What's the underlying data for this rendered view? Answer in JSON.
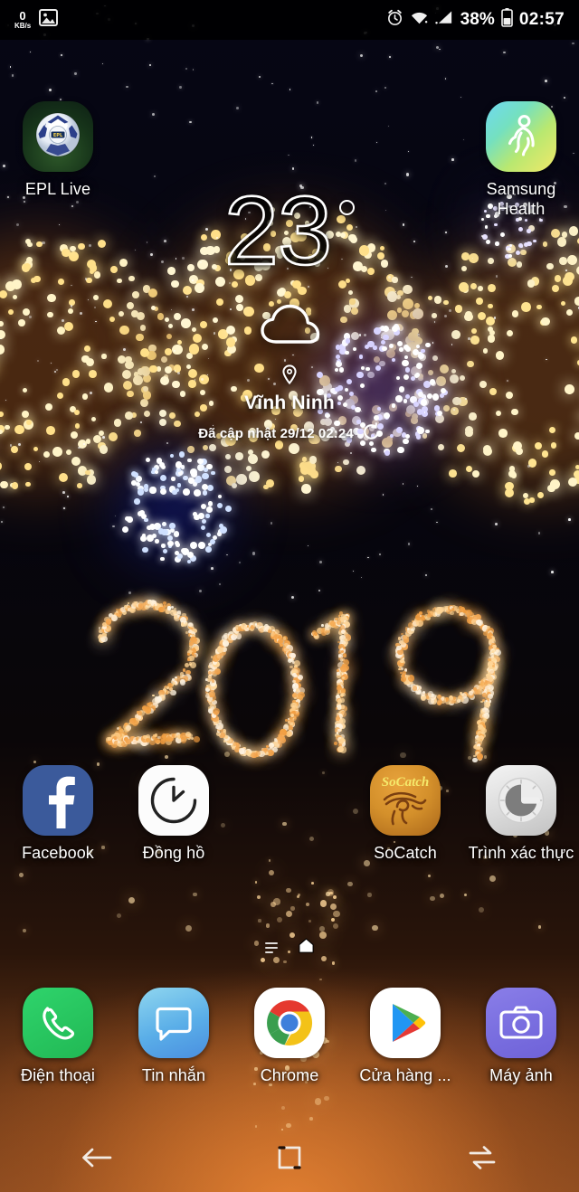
{
  "status_bar": {
    "network_speed_value": "0",
    "network_speed_unit": "KB/s",
    "battery_percent": "38%",
    "clock": "02:57",
    "icons": [
      "gallery-icon",
      "alarm-icon",
      "wifi-icon",
      "signal-icon",
      "battery-icon"
    ]
  },
  "weather_widget": {
    "temperature": "23",
    "degree_symbol": "°",
    "condition_icon": "cloud-icon",
    "location": "Vĩnh Ninh",
    "updated_text": "Đã cập nhật 29/12 02:24",
    "refresh_icon": "refresh-icon"
  },
  "wallpaper": {
    "year_text": "2019",
    "theme": "fireworks-new-year"
  },
  "home_rows": {
    "top_row": [
      {
        "label": "EPL Live",
        "icon": "soccer-ball-icon",
        "slot": 1
      },
      {
        "label": "Samsung Health",
        "icon": "running-figure-icon",
        "slot": 5
      }
    ],
    "middle_row": [
      {
        "label": "Facebook",
        "icon": "facebook-icon",
        "slot": 1
      },
      {
        "label": "Đồng hồ",
        "icon": "clock-icon",
        "slot": 2
      },
      {
        "label": "SoCatch",
        "icon": "eye-of-horus-icon",
        "slot": 4
      },
      {
        "label": "Trình xác thực",
        "icon": "authenticator-icon",
        "slot": 5
      }
    ]
  },
  "page_indicator": {
    "home_icon": "home-icon",
    "pages": 2,
    "current": "home"
  },
  "dock": [
    {
      "label": "Điện thoại",
      "icon": "phone-icon"
    },
    {
      "label": "Tin nhắn",
      "icon": "message-icon"
    },
    {
      "label": "Chrome",
      "icon": "chrome-icon"
    },
    {
      "label": "Cửa hàng ...",
      "icon": "play-store-icon"
    },
    {
      "label": "Máy ảnh",
      "icon": "camera-icon"
    }
  ],
  "nav_bar": [
    {
      "name": "back",
      "icon": "back-arrow-icon"
    },
    {
      "name": "home",
      "icon": "home-square-icon"
    },
    {
      "name": "recents",
      "icon": "recents-icon"
    }
  ],
  "colors": {
    "facebook_blue": "#3b5a9b",
    "phone_green": "#22c35e",
    "message_blue": "#4aa3e8",
    "camera_purple": "#7b70e0",
    "socatch_orange": "#d4902b",
    "auth_gray": "#9b9b9b",
    "wallpaper_base": "#05050f",
    "smoke_amber": "#8a4c22"
  }
}
